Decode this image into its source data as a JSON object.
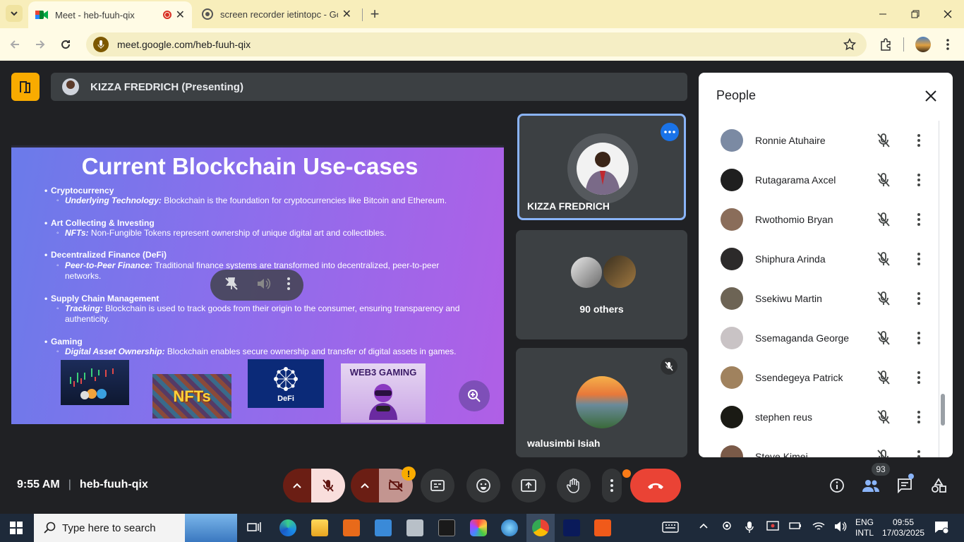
{
  "browser": {
    "tabs": [
      {
        "title": "Meet - heb-fuuh-qix",
        "active": true
      },
      {
        "title": "screen recorder ietintopc - Goo",
        "active": false
      }
    ],
    "url": "meet.google.com/heb-fuuh-qix"
  },
  "meet": {
    "presenter_label": "KIZZA FREDRICH (Presenting)",
    "slide": {
      "title": "Current Blockchain Use-cases",
      "sections": [
        {
          "heading": "Cryptocurrency",
          "term": "Underlying Technology:",
          "text": " Blockchain is the foundation for cryptocurrencies like Bitcoin and Ethereum."
        },
        {
          "heading": "Art Collecting & Investing",
          "term": "NFTs:",
          "text": " Non-Fungible Tokens represent ownership of unique digital art and collectibles."
        },
        {
          "heading": "Decentralized Finance (DeFi)",
          "term": "Peer-to-Peer Finance:",
          "text": " Traditional finance systems are transformed into decentralized, peer-to-peer networks."
        },
        {
          "heading": "Supply Chain Management",
          "term": "Tracking:",
          "text": " Blockchain is used to track goods from their origin to the consumer, ensuring transparency and authenticity."
        },
        {
          "heading": "Gaming",
          "term": "Digital Asset Ownership:",
          "text": " Blockchain enables secure ownership and transfer of digital assets in games."
        }
      ],
      "images": [
        "NFTs",
        "DeFi",
        "WEB3 GAMING"
      ]
    },
    "tiles": [
      {
        "name": "KIZZA FREDRICH"
      },
      {
        "name": "90 others"
      },
      {
        "name": "walusimbi Isiah"
      }
    ],
    "people_panel": {
      "title": "People",
      "participants": [
        {
          "name": "Ronnie Atuhaire",
          "color": "#7b8aa3"
        },
        {
          "name": "Rutagarama Axcel",
          "color": "#1f1f1f"
        },
        {
          "name": "Rwothomio Bryan",
          "color": "#8a6d5a"
        },
        {
          "name": "Shiphura Arinda",
          "color": "#2c2a2a"
        },
        {
          "name": "Ssekiwu Martin",
          "color": "#6d6455"
        },
        {
          "name": "Ssemaganda George",
          "color": "#c9c3c5"
        },
        {
          "name": "Ssendegeya Patrick",
          "color": "#a0825e"
        },
        {
          "name": "stephen reus",
          "color": "#1a1a14"
        },
        {
          "name": "Steve Kimei",
          "color": "#7a5a48"
        }
      ]
    },
    "bottom": {
      "time": "9:55 AM",
      "meeting_code": "heb-fuuh-qix",
      "people_count": "93",
      "warning_badge": "!"
    }
  },
  "taskbar": {
    "search_placeholder": "Type here to search",
    "lang1": "ENG",
    "lang2": "INTL",
    "time": "09:55",
    "date": "17/03/2025"
  },
  "colors": {
    "accent_blue": "#8ab4f8",
    "end_call": "#ea4335",
    "muted_red": "#f9dedc",
    "amber": "#f9ab00"
  }
}
